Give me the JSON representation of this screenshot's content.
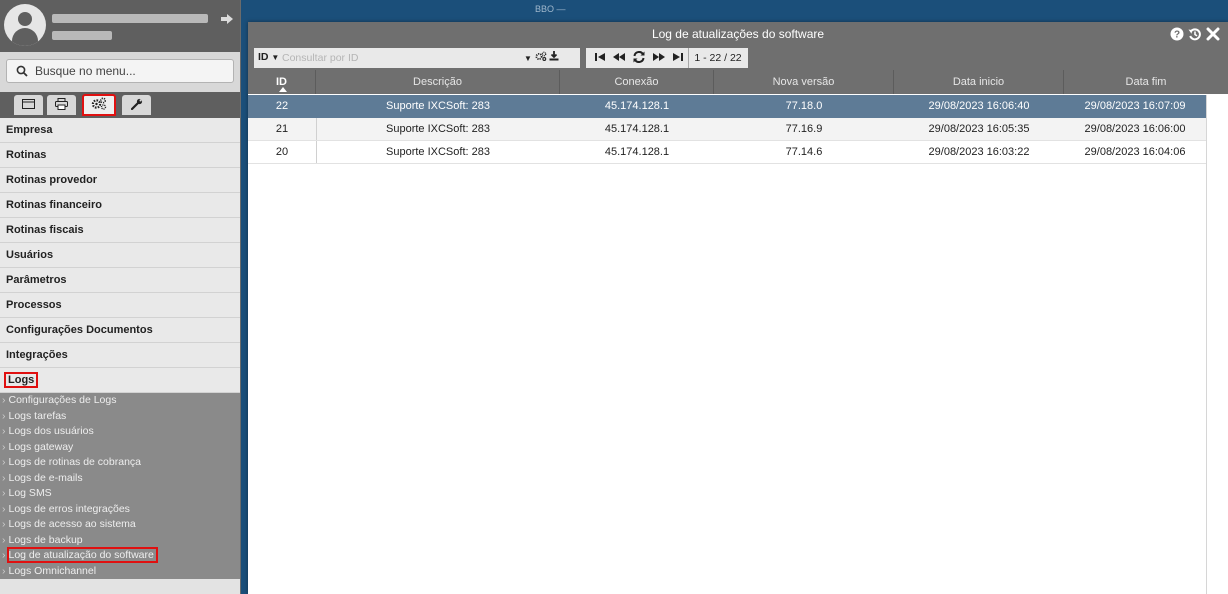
{
  "sidebar": {
    "search_placeholder": "Busque no menu...",
    "tabs": [
      {
        "icon": "list-icon"
      },
      {
        "icon": "print-icon"
      },
      {
        "icon": "gears-icon",
        "active": true
      },
      {
        "icon": "wrench-icon"
      }
    ],
    "menu": [
      {
        "label": "Empresa"
      },
      {
        "label": "Rotinas"
      },
      {
        "label": "Rotinas provedor"
      },
      {
        "label": "Rotinas financeiro"
      },
      {
        "label": "Rotinas fiscais"
      },
      {
        "label": "Usuários"
      },
      {
        "label": "Parâmetros"
      },
      {
        "label": "Processos"
      },
      {
        "label": "Configurações Documentos"
      },
      {
        "label": "Integrações"
      },
      {
        "label": "Logs",
        "highlighted": true
      }
    ],
    "submenu": [
      {
        "label": "Configurações de Logs"
      },
      {
        "label": "Logs tarefas"
      },
      {
        "label": "Logs dos usuários"
      },
      {
        "label": "Logs gateway"
      },
      {
        "label": "Logs de rotinas de cobrança"
      },
      {
        "label": "Logs de e-mails"
      },
      {
        "label": "Log SMS"
      },
      {
        "label": "Logs de erros integrações"
      },
      {
        "label": "Logs de acesso ao sistema"
      },
      {
        "label": "Logs de backup"
      },
      {
        "label": "Log de atualização do software",
        "highlighted": true
      },
      {
        "label": "Logs Omnichannel"
      }
    ]
  },
  "background": {
    "label": "BBO —"
  },
  "window": {
    "title": "Log de atualizações do software",
    "title_icons": [
      "help-icon",
      "history-icon",
      "close-icon"
    ],
    "filter": {
      "field_label": "ID",
      "placeholder": "Consultar por ID"
    },
    "pager": {
      "count_label": "1 - 22 / 22"
    },
    "columns": [
      "ID",
      "Descrição",
      "Conexão",
      "Nova versão",
      "Data inicio",
      "Data fim"
    ],
    "rows": [
      {
        "id": "22",
        "descricao": "Suporte IXCSoft: 283",
        "conexao": "45.174.128.1",
        "versao": "77.18.0",
        "inicio": "29/08/2023 16:06:40",
        "fim": "29/08/2023 16:07:09",
        "selected": true
      },
      {
        "id": "21",
        "descricao": "Suporte IXCSoft: 283",
        "conexao": "45.174.128.1",
        "versao": "77.16.9",
        "inicio": "29/08/2023 16:05:35",
        "fim": "29/08/2023 16:06:00"
      },
      {
        "id": "20",
        "descricao": "Suporte IXCSoft: 283",
        "conexao": "45.174.128.1",
        "versao": "77.14.6",
        "inicio": "29/08/2023 16:03:22",
        "fim": "29/08/2023 16:04:06"
      }
    ]
  },
  "colors": {
    "highlight": "#e01010",
    "selected_row": "#5e7b96",
    "header": "#6f6f6f",
    "background": "#1b4f7a"
  }
}
